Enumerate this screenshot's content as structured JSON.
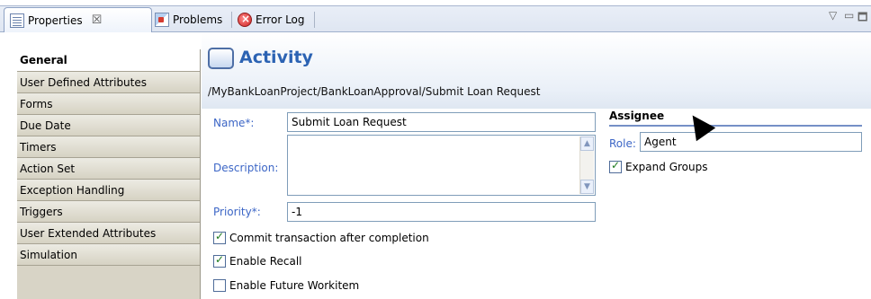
{
  "tabs": {
    "properties": "Properties",
    "properties_close": "☒",
    "problems": "Problems",
    "error_log": "Error Log"
  },
  "view_controls": {
    "menu": "▽",
    "minimize": "▭",
    "maximize": "🗖"
  },
  "nav": {
    "items": [
      "General",
      "User Defined Attributes",
      "Forms",
      "Due Date",
      "Timers",
      "Action Set",
      "Exception Handling",
      "Triggers",
      "User Extended Attributes",
      "Simulation"
    ],
    "selected_index": 0
  },
  "header": {
    "title": "Activity",
    "path": "/MyBankLoanProject/BankLoanApproval/Submit Loan Request"
  },
  "form": {
    "name_label": "Name*:",
    "name_value": "Submit Loan Request",
    "description_label": "Description:",
    "description_value": "",
    "priority_label": "Priority*:",
    "priority_value": "-1",
    "commit_label": "Commit transaction after completion",
    "commit_checked": true,
    "recall_label": "Enable Recall",
    "recall_checked": true,
    "future_label": "Enable Future Workitem",
    "future_checked": false
  },
  "assignee": {
    "title": "Assignee",
    "role_label": "Role:",
    "role_value": "Agent",
    "expand_label": "Expand Groups",
    "expand_checked": true
  },
  "colors": {
    "title_blue": "#2c63b3",
    "label_blue": "#3c66c6",
    "nav_bg": "#d8d4c6"
  }
}
